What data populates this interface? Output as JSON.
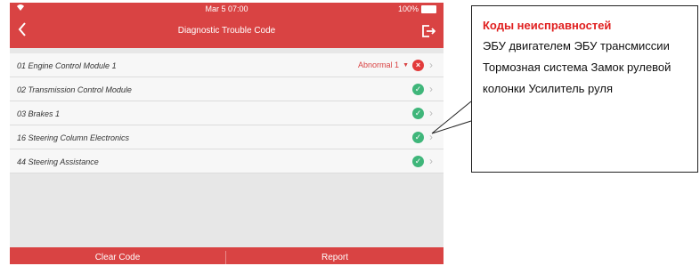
{
  "status_bar": {
    "time": "Mar 5 07:00",
    "battery": "100%"
  },
  "header": {
    "title": "Diagnostic Trouble Code"
  },
  "rows": [
    {
      "label": "01 Engine Control Module 1",
      "status": "Abnormal 1"
    },
    {
      "label": "02 Transmission Control Module"
    },
    {
      "label": "03 Brakes 1"
    },
    {
      "label": "16 Steering Column Electronics"
    },
    {
      "label": "44 Steering Assistance"
    }
  ],
  "footer": {
    "clear_label": "Clear Code",
    "report_label": "Report"
  },
  "callout": {
    "title": "Коды неисправностей",
    "text": "ЭБУ двигателем ЭБУ трансмиссии Тормозная система Замок рулевой колонки Усилитель руля"
  },
  "colors": {
    "brand": "#d94343",
    "ok": "#3fb67a",
    "error": "#e23b3b"
  }
}
